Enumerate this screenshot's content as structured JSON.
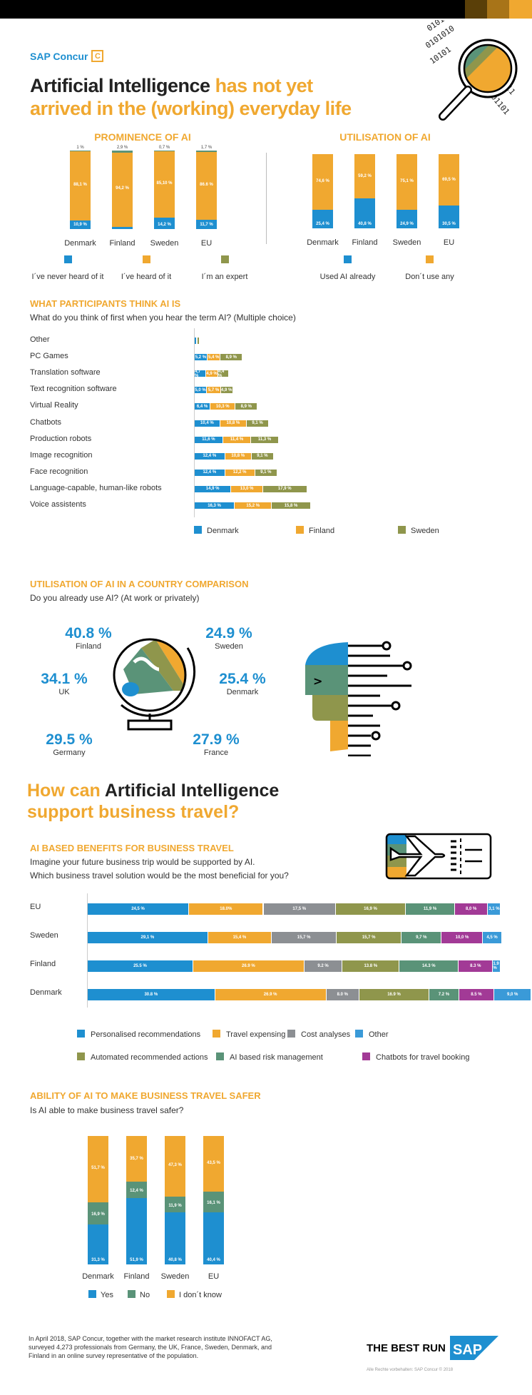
{
  "header": {
    "brand": "SAP Concur",
    "brand_icon": "concur-c-logo",
    "title_black": "Artificial Intelligence",
    "title_orange_1": "has not yet",
    "title_orange_2": "arrived in the (working) everyday life",
    "top_swatches": [
      "#5a3f08",
      "#a87418",
      "#f0a830"
    ]
  },
  "colors": {
    "blue": "#1e8fd0",
    "orange": "#f0a830",
    "olive": "#8f964c",
    "teal": "#5a9378",
    "gray": "#8c8f93",
    "purple": "#a23a96",
    "lightblue": "#3a9ad8"
  },
  "chart_data": [
    {
      "id": "prominence",
      "type": "bar",
      "stacked": true,
      "title": "PROMINENCE OF AI",
      "categories": [
        "Denmark",
        "Finland",
        "Sweden",
        "EU"
      ],
      "series": [
        {
          "name": "I´ve never heard of it",
          "color": "#1e8fd0",
          "values": [
            10.9,
            2.9,
            14.2,
            11.7
          ],
          "labels": [
            "10,9 %",
            "2,9 %",
            "14,2 %",
            "11,7 %"
          ]
        },
        {
          "name": "I´ve heard of it",
          "color": "#f0a830",
          "values": [
            88.1,
            94.2,
            85.1,
            86.6
          ],
          "labels": [
            "88,1 %",
            "94,2 %",
            "85,10 %",
            "86.6 %"
          ]
        },
        {
          "name": "I´m an expert",
          "color": "#5a9378",
          "legend_color": "#8f964c",
          "values": [
            1.0,
            2.9,
            0.7,
            1.7
          ],
          "labels": [
            "1 %",
            "2,9 %",
            "0,7 %",
            "1,7 %"
          ]
        }
      ],
      "ylim": [
        0,
        100
      ]
    },
    {
      "id": "utilisation",
      "type": "bar",
      "stacked": true,
      "title": "UTILISATION OF AI",
      "categories": [
        "Denmark",
        "Finland",
        "Sweden",
        "EU"
      ],
      "series": [
        {
          "name": "Used AI already",
          "color": "#1e8fd0",
          "values": [
            25.4,
            40.8,
            24.9,
            30.5
          ],
          "labels": [
            "25,4 %",
            "40,8 %",
            "24,9 %",
            "30,5 %"
          ]
        },
        {
          "name": "Don´t use any",
          "color": "#f0a830",
          "values": [
            74.6,
            59.2,
            75.1,
            69.5
          ],
          "labels": [
            "74,6 %",
            "59,2 %",
            "75,1 %",
            "69,5 %"
          ]
        }
      ],
      "ylim": [
        0,
        100
      ]
    },
    {
      "id": "think-ai",
      "type": "bar",
      "orientation": "horizontal",
      "stacked": true,
      "title": "WHAT PARTICIPANTS THINK AI IS",
      "subtitle": "What do you think of first when you hear the term AI? (Multiple choice)",
      "categories": [
        "Other",
        "PC Games",
        "Translation software",
        "Text recognition software",
        "Virtual Reality",
        "Chatbots",
        "Production robots",
        "Image recognition",
        "Face recognition",
        "Language-capable, human-like robots",
        "Voice assistents"
      ],
      "series": [
        {
          "name": "Denmark",
          "color": "#1e8fd0",
          "values": [
            0.8,
            5.2,
            4.7,
            5.0,
            6.4,
            10.4,
            11.6,
            12.4,
            12.4,
            14.9,
            16.3
          ],
          "labels": [
            "",
            "5,2 %",
            "4,7 %",
            "5,0 %",
            "6,4 %",
            "10,4 %",
            "11,6 %",
            "12,4 %",
            "12,4 %",
            "14,9 %",
            "16,3 %"
          ]
        },
        {
          "name": "Finland",
          "color": "#f0a830",
          "values": [
            0.5,
            5.4,
            4.9,
            5.7,
            10.3,
            10.8,
            11.4,
            10.8,
            12.2,
            13.0,
            15.2
          ],
          "labels": [
            "",
            "5,4 %",
            "4,9 %",
            "5,7 %",
            "10,3 %",
            "10,8 %",
            "11,4 %",
            "10,8 %",
            "12,2 %",
            "13,0 %",
            "15,2 %"
          ]
        },
        {
          "name": "Sweden",
          "color": "#8f964c",
          "values": [
            0.8,
            8.9,
            4.4,
            4.9,
            8.9,
            9.1,
            11.3,
            9.1,
            9.1,
            17.9,
            15.8
          ],
          "labels": [
            "",
            "8,9 %",
            "4,4 %",
            "4,9 %",
            "8,9 %",
            "9,1 %",
            "11,3 %",
            "9,1 %",
            "9,1 %",
            "17,9 %",
            "15,8 %"
          ]
        }
      ],
      "legend": "bottom"
    },
    {
      "id": "country-comparison",
      "type": "table",
      "title": "UTILISATION OF AI IN A COUNTRY COMPARISON",
      "subtitle": "Do you already use AI? (At work or privately)",
      "items": [
        {
          "country": "Finland",
          "value": "40.8 %"
        },
        {
          "country": "Sweden",
          "value": "24.9 %"
        },
        {
          "country": "UK",
          "value": "34.1 %"
        },
        {
          "country": "Denmark",
          "value": "25.4 %"
        },
        {
          "country": "Germany",
          "value": "29.5 %"
        },
        {
          "country": "France",
          "value": "27.9 %"
        }
      ]
    },
    {
      "id": "benefits",
      "type": "bar",
      "orientation": "horizontal",
      "stacked": true,
      "title": "AI BASED BENEFITS FOR BUSINESS TRAVEL",
      "subtitle_1": "Imagine your future business trip would be supported by AI.",
      "subtitle_2": "Which business travel solution would be the most beneficial for you?",
      "categories": [
        "EU",
        "Sweden",
        "Finland",
        "Denmark"
      ],
      "series": [
        {
          "name": "Personalised recommendations",
          "color": "#1e8fd0",
          "values": [
            24.5,
            29.1,
            25.5,
            30.8
          ],
          "labels": [
            "24,5 %",
            "29,1 %",
            "25.5 %",
            "30.8 %"
          ]
        },
        {
          "name": "Travel expensing",
          "color": "#f0a830",
          "values": [
            18.0,
            15.4,
            26.9,
            26.9
          ],
          "labels": [
            "18.0%",
            "15,4 %",
            "26.9 %",
            "26.9 %"
          ]
        },
        {
          "name": "Cost analyses",
          "color": "#8c8f93",
          "values": [
            17.5,
            15.7,
            9.2,
            8.0
          ],
          "labels": [
            "17,5 %",
            "15,7 %",
            "9.2 %",
            "8.0 %"
          ]
        },
        {
          "name": "Automated recommended actions",
          "color": "#8f964c",
          "values": [
            16.9,
            15.7,
            13.8,
            16.9
          ],
          "labels": [
            "16,9 %",
            "15,7 %",
            "13.8 %",
            "16.9 %"
          ]
        },
        {
          "name": "AI based risk management",
          "color": "#5a9378",
          "values": [
            11.9,
            9.7,
            14.3,
            7.2
          ],
          "labels": [
            "11,9 %",
            "9,7 %",
            "14.3 %",
            "7.2 %"
          ]
        },
        {
          "name": "Chatbots for travel booking",
          "color": "#a23a96",
          "values": [
            8.0,
            10.0,
            8.3,
            8.5
          ],
          "labels": [
            "8,0 %",
            "10,0 %",
            "8.3 %",
            "8.5 %"
          ]
        },
        {
          "name": "Other",
          "color": "#3a9ad8",
          "values": [
            3.1,
            4.5,
            1.9,
            9.0
          ],
          "labels": [
            "3,1 %",
            "4,5 %",
            "1.9 %",
            "9,0 %"
          ]
        }
      ],
      "legend_order": [
        "Personalised recommendations",
        "Travel expensing",
        "Cost analyses",
        "Other",
        "Automated recommended actions",
        "AI based risk management",
        "Chatbots for travel booking"
      ],
      "legend": "bottom"
    },
    {
      "id": "safer",
      "type": "bar",
      "stacked": true,
      "title": "ABILITY OF AI TO MAKE BUSINESS TRAVEL SAFER",
      "subtitle": "Is AI able to make business travel safer?",
      "categories": [
        "Denmark",
        "Finland",
        "Sweden",
        "EU"
      ],
      "series": [
        {
          "name": "Yes",
          "color": "#1e8fd0",
          "values": [
            31.3,
            51.9,
            40.8,
            40.4
          ],
          "labels": [
            "31,3 %",
            "51,9 %",
            "40,8 %",
            "40,4 %"
          ]
        },
        {
          "name": "No",
          "color": "#5a9378",
          "values": [
            16.9,
            12.4,
            11.9,
            16.1
          ],
          "labels": [
            "16,9 %",
            "12,4 %",
            "11,9 %",
            "16,1 %"
          ]
        },
        {
          "name": "I don´t know",
          "color": "#f0a830",
          "values": [
            51.7,
            35.7,
            47.3,
            43.5
          ],
          "labels": [
            "51,7 %",
            "35,7 %",
            "47,3 %",
            "43,5 %"
          ]
        }
      ],
      "ylim": [
        0,
        100
      ]
    }
  ],
  "section2": {
    "title_orange_1": "How can",
    "title_black": "Artificial Intelligence",
    "title_orange_2": "support business travel?"
  },
  "footer": {
    "note_1": "In April 2018, SAP Concur, together with the market research institute INNOFACT AG,",
    "note_2": "surveyed 4,273 professionals from Germany, the UK, France, Sweden, Denmark, and",
    "note_3": "Finland in an online survey representative of the population.",
    "tagline": "THE BEST RUN",
    "logo": "SAP",
    "copyright": "Alle Rechte vorbehalten: SAP Concur © 2018"
  }
}
